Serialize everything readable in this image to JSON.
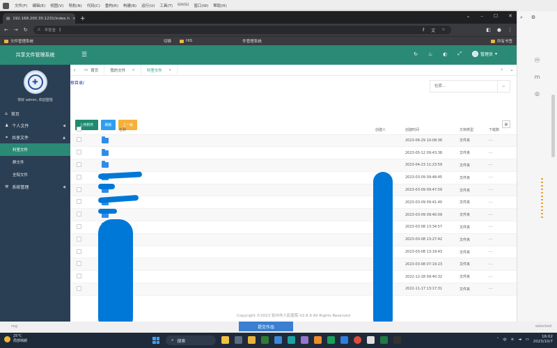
{
  "ide": {
    "menu": [
      "文件(F)",
      "编辑(E)",
      "视图(V)",
      "导航(N)",
      "代码(C)",
      "重构(R)",
      "构建(B)",
      "运行(U)",
      "工具(T)",
      "Git(G)",
      "窗口(W)",
      "帮助(H)"
    ],
    "status_left": "reg",
    "status_right": "selected",
    "submit_button": "提交作品"
  },
  "browser": {
    "tab_title": "192.168.200.35:1231/index.h",
    "tab_close": "×",
    "new_tab": "+",
    "insecure_label": "不安全",
    "window_controls": [
      "⌄",
      "–",
      "☐",
      "✕"
    ],
    "bookmarks": [
      "文件管理系统",
      "切换",
      "HIS",
      "件管理系统"
    ],
    "bookmarks_right": "所有书签",
    "nav": {
      "back": "←",
      "forward": "→",
      "reload": "↻"
    }
  },
  "app": {
    "title": "共享文件管理系统",
    "welcome": "你好 admin, 欢迎登陆",
    "user_label": "管理员",
    "menu": {
      "home": "首页",
      "personal": "个人文件",
      "shared": "共享文件",
      "shared_sub": [
        "科室文件",
        "群文件",
        "全院文件"
      ],
      "system": "系统管理"
    },
    "tabs": [
      {
        "label": "首页",
        "closable": false
      },
      {
        "label": "我的文件",
        "closable": true
      },
      {
        "label": "科室文件",
        "closable": true,
        "active": true
      }
    ],
    "breadcrumb": "根目录/",
    "search_placeholder": "检索...",
    "buttons": {
      "upload": "上传附件",
      "refresh": "刷新",
      "up": "上一级"
    },
    "table": {
      "headers": [
        "名称",
        "创建人",
        "创建时间",
        "文档类型",
        "下载数"
      ],
      "rows": [
        {
          "time": "2023-06-29 10:08:36",
          "type": "文件夹",
          "downloads": "- -"
        },
        {
          "time": "2023-05-12 09:43:38",
          "type": "文件夹",
          "downloads": "- -"
        },
        {
          "time": "2023-04-23 11:23:59",
          "type": "文件夹",
          "downloads": "- -"
        },
        {
          "time": "2023-03-09 09:48:45",
          "type": "文件夹",
          "downloads": "- -"
        },
        {
          "time": "2023-03-09 09:47:59",
          "type": "文件夹",
          "downloads": "- -"
        },
        {
          "time": "2023-03-09 09:41:40",
          "type": "文件夹",
          "downloads": "- -"
        },
        {
          "time": "2023-03-09 09:40:09",
          "type": "文件夹",
          "downloads": "- -"
        },
        {
          "time": "2023-03-08 13:34:57",
          "type": "文件夹",
          "downloads": "- -"
        },
        {
          "time": "2023-03-08 13:27:42",
          "type": "文件夹",
          "downloads": "- -"
        },
        {
          "time": "2023-03-08 13:19:43",
          "type": "文件夹",
          "downloads": "- -"
        },
        {
          "time": "2023-03-08 07:19:23",
          "type": "文件夹",
          "downloads": "- -"
        },
        {
          "time": "2022-12-28 09:40:32",
          "type": "文件夹",
          "downloads": "- -"
        },
        {
          "time": "2022-11-17 13:17:31",
          "type": "文件夹",
          "downloads": "- -"
        }
      ]
    },
    "footer": "Copyright ©2023 钦州市人民医院 V2.6.9 All Rights Reserved"
  },
  "taskbar": {
    "weather_temp": "25°C",
    "weather_desc": "局部晴朗",
    "search": "搜索",
    "lang": "中",
    "time": "16:02",
    "date": "2023/10/7"
  },
  "colors": {
    "teal": "#2b8a76",
    "sidebar": "#2a3f54",
    "folder": "#2d8de8",
    "redaction": "#0078d7"
  }
}
